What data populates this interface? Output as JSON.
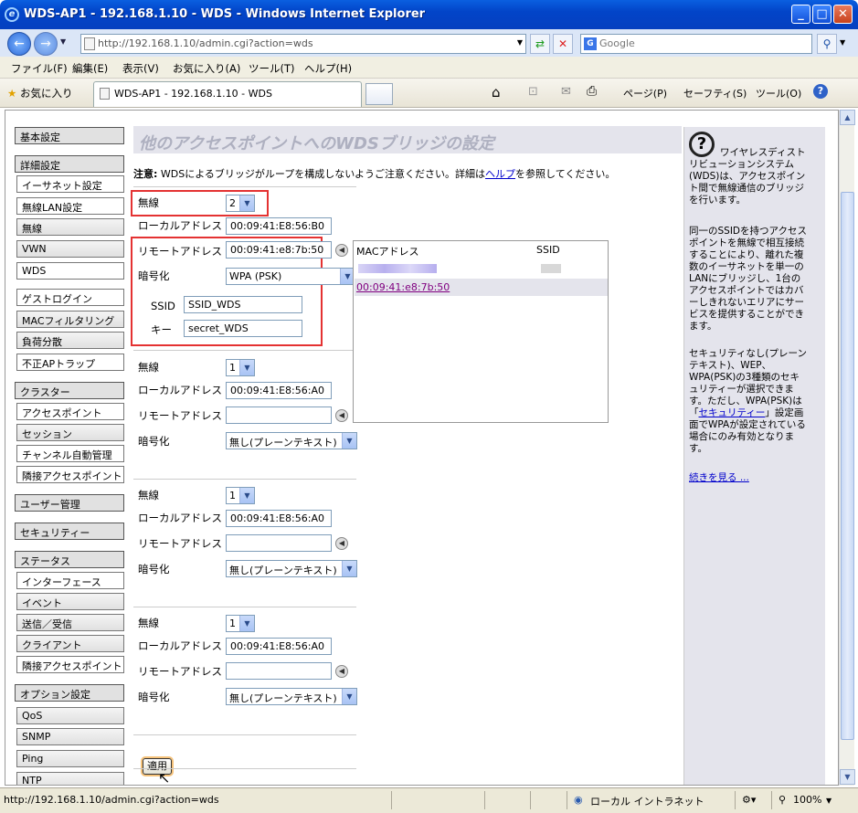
{
  "window": {
    "title": "WDS-AP1 - 192.168.1.10 - WDS - Windows Internet Explorer",
    "address": "http://192.168.1.10/admin.cgi?action=wds",
    "search_placeholder": "Google",
    "menu": [
      "ファイル(F)",
      "編集(E)",
      "表示(V)",
      "お気に入り(A)",
      "ツール(T)",
      "ヘルプ(H)"
    ],
    "favorites": "お気に入り",
    "tab_title": "WDS-AP1 - 192.168.1.10 - WDS",
    "cmd": [
      "ページ(P)",
      "セーフティ(S)",
      "ツール(O)"
    ]
  },
  "sidebar": {
    "items": [
      "基本設定",
      "詳細設定",
      "イーサネット設定",
      "無線LAN設定",
      "無線",
      "VWN",
      "WDS",
      "ゲストログイン",
      "MACフィルタリング",
      "負荷分散",
      "不正APトラップ",
      "クラスター",
      "アクセスポイント",
      "セッション",
      "チャンネル自動管理",
      "隣接アクセスポイント",
      "ユーザー管理",
      "セキュリティー",
      "ステータス",
      "インターフェース",
      "イベント",
      "送信／受信",
      "クライアント",
      "隣接アクセスポイント",
      "オプション設定",
      "QoS",
      "SNMP",
      "Ping",
      "NTP"
    ]
  },
  "main": {
    "heading": "他のアクセスポイントへのWDSブリッジの設定",
    "note_bold": "注意:",
    "note_text": " WDSによるブリッジがループを構成しないようご注意ください。詳細は",
    "note_link": "ヘルプ",
    "note_tail": "を参照してください。",
    "labels": {
      "radio": "無線",
      "local": "ローカルアドレス",
      "remote": "リモートアドレス",
      "encryption": "暗号化",
      "ssid": "SSID",
      "key": "キー"
    },
    "bridges": [
      {
        "radio": "2",
        "local": "00:09:41:E8:56:B0",
        "remote": "00:09:41:e8:7b:50",
        "encryption": "WPA (PSK)",
        "ssid": "SSID_WDS",
        "key": "secret_WDS"
      },
      {
        "radio": "1",
        "local": "00:09:41:E8:56:A0",
        "remote": "",
        "encryption": "無し(プレーンテキスト)"
      },
      {
        "radio": "1",
        "local": "00:09:41:E8:56:A0",
        "remote": "",
        "encryption": "無し(プレーンテキスト)"
      },
      {
        "radio": "1",
        "local": "00:09:41:E8:56:A0",
        "remote": "",
        "encryption": "無し(プレーンテキスト)"
      }
    ],
    "maclist": {
      "col_mac": "MACアドレス",
      "col_ssid": "SSID",
      "selected": "00:09:41:e8:7b:50"
    },
    "apply": "適用"
  },
  "help": {
    "p1": "ワイヤレスディストリビューションシステム(WDS)は、アクセスポイント間で無線通信のブリッジを行います。",
    "p2": "同一のSSIDを持つアクセスポイントを無線で相互接続することにより、離れた複数のイーサネットを単一のLANにブリッジし、1台のアクセスポイントではカバーしきれないエリアにサービスを提供することができます。",
    "p3a": "セキュリティなし(プレーンテキスト)、WEP、WPA(PSK)の3種類のセキュリティーが選択できます。ただし、WPA(PSK)は「",
    "p3link": "セキュリティー",
    "p3b": "」設定画面でWPAが設定されている場合にのみ有効となります。",
    "more": "続きを見る ..."
  },
  "status": {
    "url": "http://192.168.1.10/admin.cgi?action=wds",
    "zone": "ローカル イントラネット",
    "zoom": "100%"
  }
}
